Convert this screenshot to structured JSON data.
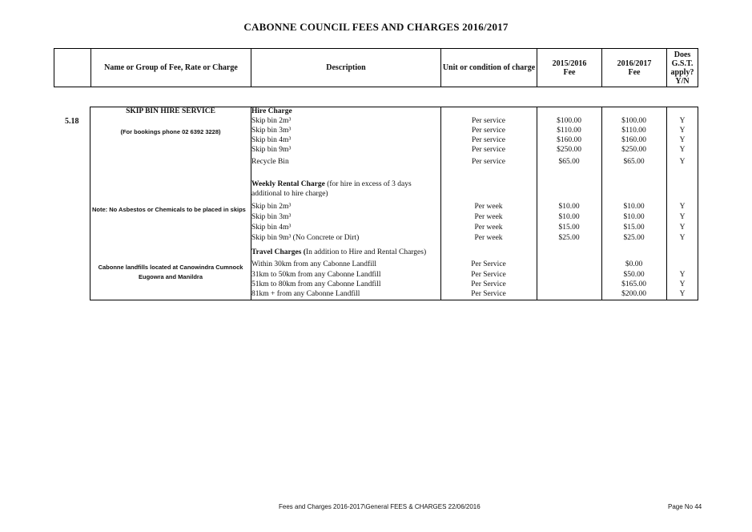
{
  "title": "CABONNE COUNCIL FEES AND CHARGES 2016/2017",
  "header": {
    "name": "Name or Group of Fee, Rate or Charge",
    "description": "Description",
    "unit": "Unit or condition of charge",
    "fee_prev": "2015/2016 Fee",
    "fee_curr": "2016/2017 Fee",
    "gst": "Does G.S.T. apply? Y/N"
  },
  "section": {
    "number": "5.18",
    "name": "SKIP BIN HIRE SERVICE",
    "bookings_note": "(For bookings phone 02 6392 3228)",
    "asbestos_note": "Note: No Asbestos or Chemicals to be placed in skips",
    "landfills_note_1": "Cabonne landfills located at Canowindra Cumnock",
    "landfills_note_2": "Eugowra and Manildra"
  },
  "groups": {
    "hire": "Hire Charge",
    "weekly_bold": "Weekly Rental Charge",
    "weekly_rest_1": "(for hire in excess of 3 days",
    "weekly_rest_2": "additional to hire charge)",
    "travel_bold": "Travel Charges (",
    "travel_rest": "In addition to Hire and Rental Charges)"
  },
  "rows": {
    "hire": [
      {
        "desc": "Skip bin  2m³",
        "unit": "Per service",
        "prev": "$100.00",
        "curr": "$100.00",
        "gst": "Y"
      },
      {
        "desc": "Skip bin  3m³",
        "unit": "Per service",
        "prev": "$110.00",
        "curr": "$110.00",
        "gst": "Y"
      },
      {
        "desc": "Skip bin 4m³",
        "unit": "Per service",
        "prev": "$160.00",
        "curr": "$160.00",
        "gst": "Y"
      },
      {
        "desc": "Skip bin 9m³",
        "unit": "Per service",
        "prev": "$250.00",
        "curr": "$250.00",
        "gst": "Y"
      },
      {
        "desc": "Recycle Bin",
        "unit": "Per service",
        "prev": "$65.00",
        "curr": "$65.00",
        "gst": "Y"
      }
    ],
    "weekly": [
      {
        "desc": "Skip bin  2m³",
        "unit": "Per week",
        "prev": "$10.00",
        "curr": "$10.00",
        "gst": "Y"
      },
      {
        "desc": "Skip bin  3m³",
        "unit": "Per week",
        "prev": "$10.00",
        "curr": "$10.00",
        "gst": "Y"
      },
      {
        "desc": "Skip bin 4m³",
        "unit": "Per week",
        "prev": "$15.00",
        "curr": "$15.00",
        "gst": "Y"
      },
      {
        "desc": "Skip bin 9m³ (No Concrete or Dirt)",
        "unit": "Per week",
        "prev": "$25.00",
        "curr": "$25.00",
        "gst": "Y"
      }
    ],
    "travel": [
      {
        "desc": "Within 30km from any Cabonne Landfill",
        "unit": "Per Service",
        "prev": "",
        "curr": "$0.00",
        "gst": ""
      },
      {
        "desc": "31km to 50km from any Cabonne Landfill",
        "unit": "Per Service",
        "prev": "",
        "curr": "$50.00",
        "gst": "Y"
      },
      {
        "desc": "51km to 80km from any Cabonne Landfill",
        "unit": "Per Service",
        "prev": "",
        "curr": "$165.00",
        "gst": "Y"
      },
      {
        "desc": "81km + from any Cabonne Landfill",
        "unit": "Per Service",
        "prev": "",
        "curr": "$200.00",
        "gst": "Y"
      }
    ]
  },
  "footer": {
    "path": "Fees and Charges 2016-2017\\General FEES & CHARGES 22/06/2016",
    "page": "Page No 44"
  }
}
